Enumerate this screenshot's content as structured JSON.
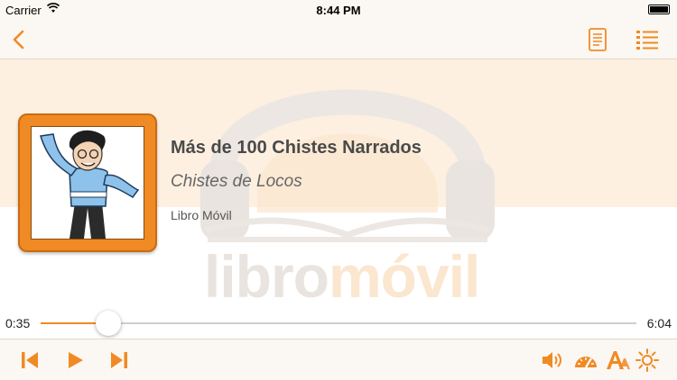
{
  "status_bar": {
    "carrier": "Carrier",
    "time": "8:44 PM"
  },
  "nav": {
    "back_icon": "chevron-left-icon",
    "document_icon": "document-icon",
    "chapters_icon": "list-icon"
  },
  "book": {
    "title": "Más de 100 Chistes Narrados",
    "subtitle": "Chistes de Locos",
    "publisher": "Libro Móvil"
  },
  "watermark": {
    "part1": "libro",
    "part2": "móvil"
  },
  "player": {
    "elapsed": "0:35",
    "total": "6:04",
    "progress_fraction": 0.114
  },
  "toolbar": {
    "icons": [
      "skip-back-icon",
      "play-icon",
      "skip-forward-icon",
      "volume-icon",
      "speed-gauge-icon",
      "font-size-icon",
      "brightness-icon"
    ]
  },
  "colors": {
    "accent": "#f08a24",
    "background_band": "#fdf0e1",
    "bar_background": "#fbf7f2"
  }
}
